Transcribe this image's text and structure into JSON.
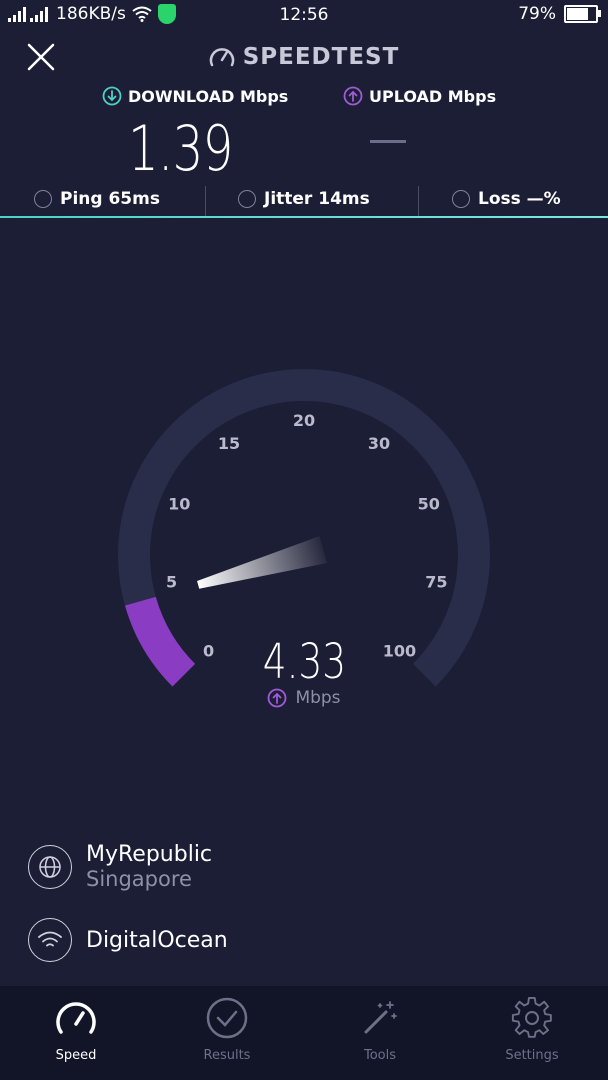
{
  "status_bar": {
    "network_speed": "186KB/s",
    "time": "12:56",
    "battery": "79%",
    "battery_level": 0.79
  },
  "header": {
    "title": "SPEEDTEST",
    "download_label": "DOWNLOAD Mbps",
    "upload_label": "UPLOAD Mbps",
    "download_value": "1.39",
    "upload_value": "—"
  },
  "stats": {
    "ping": "Ping 65ms",
    "jitter": "Jitter 14ms",
    "loss": "Loss —%"
  },
  "gauge": {
    "ticks": [
      "0",
      "5",
      "10",
      "15",
      "20",
      "30",
      "50",
      "75",
      "100"
    ],
    "value": "4.33",
    "unit": "Mbps",
    "current_mbps": 4.33,
    "max_mbps": 100
  },
  "server": {
    "provider": "MyRepublic",
    "location": "Singapore",
    "host": "DigitalOcean"
  },
  "nav": {
    "speed": "Speed",
    "results": "Results",
    "tools": "Tools",
    "settings": "Settings"
  },
  "colors": {
    "background": "#1c1e35",
    "download_accent": "#4fd1c5",
    "upload_accent": "#a15bd8",
    "gauge_track": "#2a2d4a"
  }
}
